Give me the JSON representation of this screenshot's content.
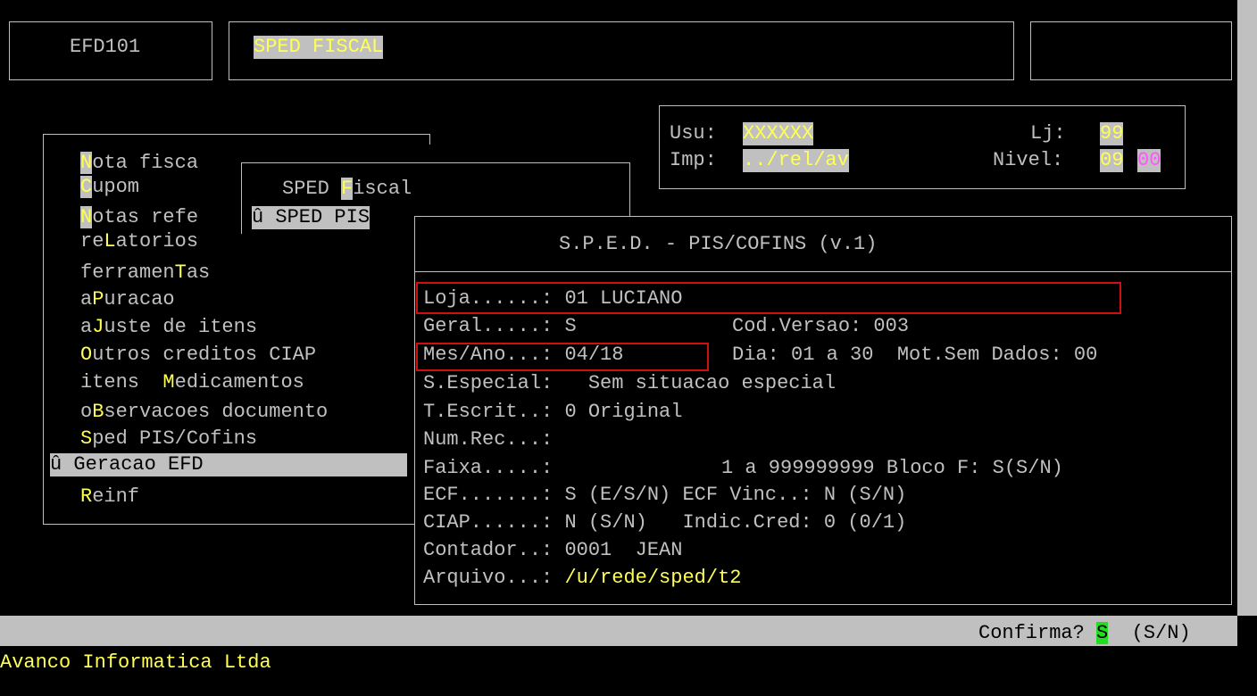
{
  "header": {
    "program_code": "EFD101",
    "title": "SPED FISCAL"
  },
  "userbox": {
    "usu_label": "Usu:",
    "usu_value": "XXXXXX",
    "lj_label": "Lj:",
    "lj_value": "99",
    "imp_label": "Imp:",
    "imp_value": "../rel/av",
    "nivel_label": "Nivel:",
    "nivel_a": "09",
    "nivel_b": "00"
  },
  "main_menu": {
    "items": [
      {
        "hot": "N",
        "rest": "ota fisca"
      },
      {
        "hot": "C",
        "rest": "upom"
      },
      {
        "hot": "N",
        "rest": "otas refe"
      },
      {
        "pre": "re",
        "hot": "L",
        "rest": "atorios"
      },
      {
        "pre": "ferramen",
        "hot": "T",
        "rest": "as"
      },
      {
        "pre": "a",
        "hot": "P",
        "rest": "uracao"
      },
      {
        "pre": "a",
        "hot": "J",
        "rest": "uste de itens"
      },
      {
        "hot": "O",
        "rest": "utros creditos CIAP"
      },
      {
        "pre": "itens  ",
        "hot": "M",
        "rest": "edicamentos"
      },
      {
        "pre": "o",
        "hot": "B",
        "rest": "servacoes documento"
      },
      {
        "hot": "S",
        "rest": "ped PIS/Cofins"
      }
    ],
    "selected_label": "û Geracao EFD",
    "reinf": {
      "hot": "R",
      "rest": "einf"
    }
  },
  "sped_submenu": {
    "pre": "SPED ",
    "hot": "F",
    "rest": "iscal",
    "selected": "û SPED PIS"
  },
  "dialog": {
    "title": "S.P.E.D. - PIS/COFINS (v.1)",
    "lines": {
      "loja": {
        "label": "Loja......:",
        "value": "01 LUCIANO"
      },
      "geral": {
        "label": "Geral.....:",
        "value": "S",
        "extra": "Cod.Versao: 003"
      },
      "mes": {
        "label": "Mes/Ano...:",
        "value": "04/18",
        "extra": "Dia: 01 a 30  Mot.Sem Dados: 00"
      },
      "especial": {
        "label": "S.Especial:",
        "value": "Sem situacao especial"
      },
      "escrit": {
        "label": "T.Escrit..:",
        "value": "0 Original"
      },
      "numrec": {
        "label": "Num.Rec...:"
      },
      "faixa": {
        "label": "Faixa.....:",
        "value": "1 a 999999999 Bloco F: S(S/N)"
      },
      "ecf": {
        "label": "ECF.......:",
        "value": "S (E/S/N) ECF Vinc..: N (S/N)"
      },
      "ciap": {
        "label": "CIAP......:",
        "value": "N (S/N)   Indic.Cred: 0 (0/1)"
      },
      "contador": {
        "label": "Contador..:",
        "value": "0001  JEAN"
      },
      "arquivo": {
        "label": "Arquivo...:",
        "value": "/u/rede/sped/t2"
      }
    }
  },
  "status": {
    "prompt": "Confirma?",
    "answer": "S",
    "options": "(S/N)"
  },
  "footer": {
    "company": "Avanco Informatica Ltda"
  },
  "colors": {
    "yellow": "#ffff55",
    "gray": "#c0c0c0",
    "magenta": "#ff55ff",
    "green": "#22dd22",
    "red": "#d01010"
  }
}
